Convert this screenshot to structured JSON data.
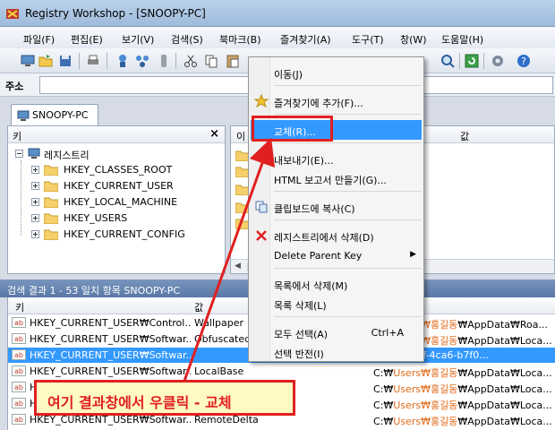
{
  "window": {
    "title": "Registry Workshop - [SNOOPY-PC]"
  },
  "menubar": {
    "items": [
      "파일(F)",
      "편집(E)",
      "보기(V)",
      "검색(S)",
      "북마크(B)",
      "즐겨찾기(A)",
      "도구(T)",
      "창(W)",
      "도움말(H)"
    ]
  },
  "toolbar": {
    "icons": [
      "computer-icon",
      "open-folder-icon",
      "save-icon",
      "print-icon",
      "connect-icon",
      "network-icon",
      "disconnect-icon",
      "cut-icon",
      "copy-icon",
      "paste-icon",
      "undo-icon",
      "redo-icon",
      "back-icon",
      "forward-icon",
      "up-icon",
      "find-icon",
      "refresh-icon",
      "options-icon",
      "help-icon"
    ]
  },
  "addressbar": {
    "label": "주소",
    "value": ""
  },
  "tab": {
    "label": "SNOOPY-PC"
  },
  "tree": {
    "header": "키",
    "close_glyph": "×",
    "root": "레지스트리",
    "keys": [
      "HKEY_CLASSES_ROOT",
      "HKEY_CURRENT_USER",
      "HKEY_LOCAL_MACHINE",
      "HKEY_USERS",
      "HKEY_CURRENT_CONFIG"
    ]
  },
  "right_pane": {
    "col_name": "이",
    "col_value": "값"
  },
  "results": {
    "title": "검색 결과 1 - 53 일치 항목 SNOOPY-PC",
    "headers": {
      "key": "키",
      "name": "값"
    },
    "rows": [
      {
        "key": "HKEY_CURRENT_USER₩Control...",
        "name": "Wallpaper",
        "v1": "C:₩",
        "v2": "Users₩홍길동",
        "v3": "₩AppData₩Roa...",
        "selected": false
      },
      {
        "key": "HKEY_CURRENT_USER₩Softwar...",
        "name": "Obfuscated",
        "v1": "C:₩",
        "v2": "Users₩홍길동",
        "v3": "₩AppData₩Loca...",
        "selected": false
      },
      {
        "key": "HKEY_CURRENT_USER₩Softwar...",
        "name": "",
        "v1": "",
        "v2": "",
        "v3": "f154e-ac3f-4ca6-b7f0...",
        "selected": true
      },
      {
        "key": "HKEY_CURRENT_USER₩Softwar...",
        "name": "LocalBase",
        "v1": "C:₩",
        "v2": "Users₩홍길동",
        "v3": "₩AppData₩Loca...",
        "selected": false
      },
      {
        "key": "HKEY_CURRENT_USER₩Softwar...",
        "name": "",
        "v1": "C:₩",
        "v2": "Users₩홍길동",
        "v3": "₩AppData₩Loca...",
        "selected": false
      },
      {
        "key": "HKEY_CURRENT_USER₩Softwar...",
        "name": "",
        "v1": "C:₩",
        "v2": "Users₩홍길동",
        "v3": "₩AppData₩Loca...",
        "selected": false
      },
      {
        "key": "HKEY_CURRENT_USER₩Softwar...",
        "name": "RemoteDelta",
        "v1": "C:₩",
        "v2": "Users₩홍길동",
        "v3": "₩AppData₩Loca...",
        "selected": false
      }
    ]
  },
  "context_menu": {
    "items": [
      {
        "label": "이동(J)",
        "shortcut": "",
        "icon": "",
        "arrow": false
      },
      {
        "label": "즐겨찾기에 추가(F)...",
        "shortcut": "",
        "icon": "star-icon",
        "arrow": false
      },
      {
        "label": "교체(R)...",
        "shortcut": "",
        "icon": "",
        "arrow": false,
        "highlighted": true
      },
      {
        "label": "내보내기(E)...",
        "shortcut": "",
        "icon": "",
        "arrow": false
      },
      {
        "label": "HTML 보고서 만들기(G)...",
        "shortcut": "",
        "icon": "",
        "arrow": false
      },
      {
        "label": "클립보드에 복사(C)",
        "shortcut": "",
        "icon": "copy-icon",
        "arrow": false
      },
      {
        "label": "레지스트리에서 삭제(D)",
        "shortcut": "",
        "icon": "delete-x-icon",
        "arrow": false
      },
      {
        "label": "Delete Parent Key",
        "shortcut": "",
        "icon": "",
        "arrow": true
      },
      {
        "label": "목록에서 삭제(M)",
        "shortcut": "",
        "icon": "",
        "arrow": false
      },
      {
        "label": "목록 삭제(L)",
        "shortcut": "",
        "icon": "",
        "arrow": false
      },
      {
        "label": "모두 선택(A)",
        "shortcut": "Ctrl+A",
        "icon": "",
        "arrow": false
      },
      {
        "label": "선택 반전(I)",
        "shortcut": "",
        "icon": "",
        "arrow": false
      }
    ]
  },
  "annotation": {
    "callout": "여기 결과창에서 우클릭 - 교체",
    "color": "#e02020"
  }
}
